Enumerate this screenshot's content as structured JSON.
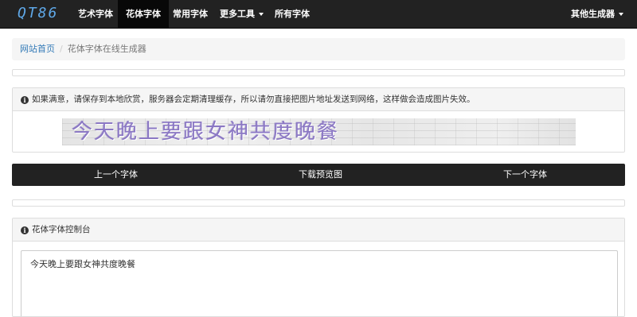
{
  "navbar": {
    "brand": "QT86",
    "items": [
      {
        "label": "艺术字体",
        "active": false
      },
      {
        "label": "花体字体",
        "active": true
      },
      {
        "label": "常用字体",
        "active": false
      },
      {
        "label": "更多工具",
        "active": false,
        "dropdown": true
      },
      {
        "label": "所有字体",
        "active": false
      }
    ],
    "right_item": {
      "label": "其他生成器",
      "dropdown": true
    }
  },
  "breadcrumb": {
    "home": "网站首页",
    "separator": "/",
    "current": "花体字体在线生成器"
  },
  "notice_panel": {
    "icon": "info-circle-icon",
    "text": "如果满意，请保存到本地欣赏，服务器会定期清理缓存，所以请勿直接把图片地址发送到网络，这样做会造成图片失效。",
    "preview_text": "今天晚上要跟女神共度晚餐"
  },
  "actions": {
    "prev": "上一个字体",
    "download": "下载预览图",
    "next": "下一个字体"
  },
  "console_panel": {
    "icon": "info-circle-icon",
    "title": "花体字体控制台",
    "input_value": "今天晚上要跟女神共度晚餐"
  },
  "colors": {
    "navbar_bg": "#222222",
    "brand": "#5fa8e8",
    "link": "#337ab7",
    "preview_text": "#8b78c4"
  }
}
